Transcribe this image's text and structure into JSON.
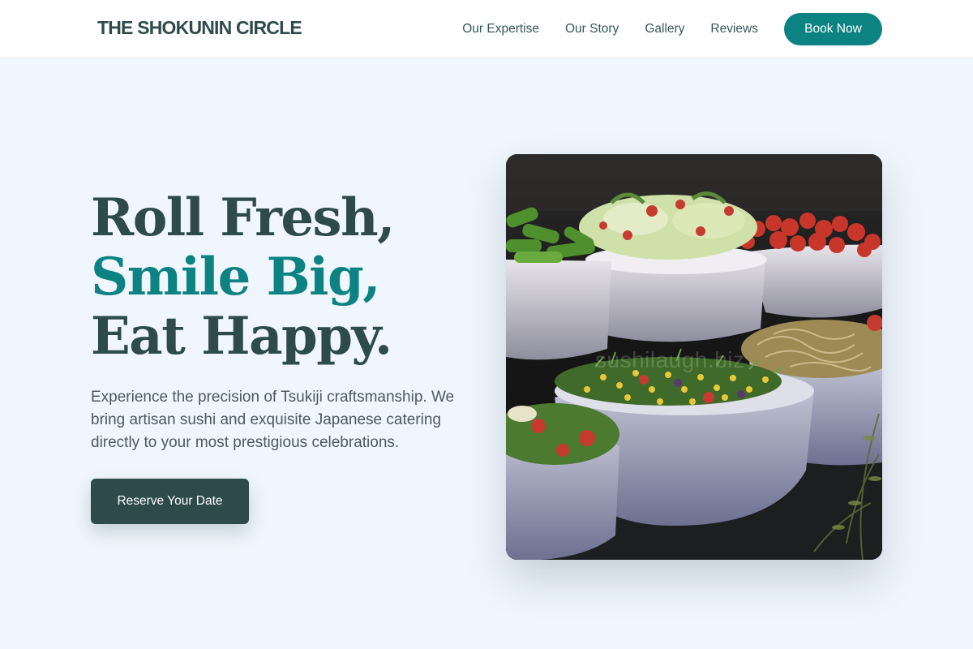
{
  "header": {
    "brand": "THE SHOKUNIN CIRCLE",
    "nav": [
      {
        "label": "Our Expertise"
      },
      {
        "label": "Our Story"
      },
      {
        "label": "Gallery"
      },
      {
        "label": "Reviews"
      }
    ],
    "cta_label": "Book Now"
  },
  "hero": {
    "headline_line1": "Roll Fresh,",
    "headline_line2": "Smile Big,",
    "headline_line3": "Eat Happy.",
    "description": "Experience the precision of Tsukiji craftsmanship. We bring artisan sushi and exquisite Japanese catering directly to your most prestigious celebrations.",
    "cta_label": "Reserve Your Date",
    "image_watermark": "sushilaugh.biz",
    "image_subject": "bowls of fresh salads on a dark buffet table"
  },
  "colors": {
    "accent": "#0c8382",
    "dark": "#2f4a4a",
    "background": "#eff6fd"
  }
}
